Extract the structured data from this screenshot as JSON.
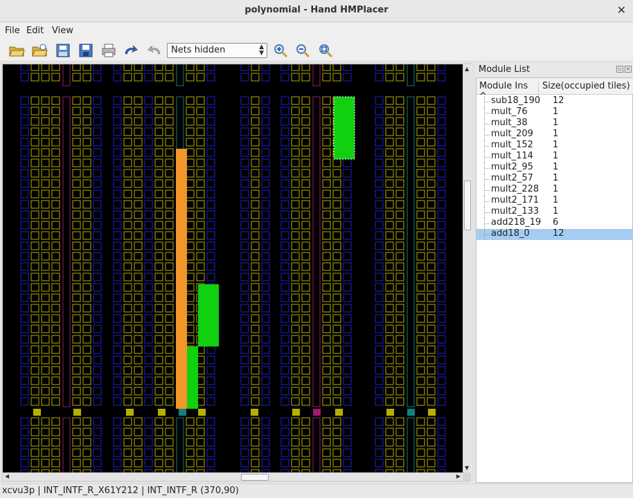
{
  "window": {
    "title": "polynomial - Hand HMPlacer",
    "close": "✕"
  },
  "menu": {
    "file": "File",
    "edit": "Edit",
    "view": "View"
  },
  "toolbar": {
    "nets_select": "Nets hidden",
    "icons": [
      "open-folder-icon",
      "open-recent-icon",
      "save-layout-icon",
      "save-icon",
      "print-icon",
      "redo-icon",
      "undo-icon",
      "zoom-in-icon",
      "zoom-out-icon",
      "zoom-fit-icon"
    ]
  },
  "module_list": {
    "title": "Module List",
    "col_instance": "Module Ins",
    "col_size": "Size(occupied tiles)",
    "items": [
      {
        "name": "sub18_190",
        "size": "12"
      },
      {
        "name": "mult_76",
        "size": "1"
      },
      {
        "name": "mult_38",
        "size": "1"
      },
      {
        "name": "mult_209",
        "size": "1"
      },
      {
        "name": "mult_152",
        "size": "1"
      },
      {
        "name": "mult_114",
        "size": "1"
      },
      {
        "name": "mult2_95",
        "size": "1"
      },
      {
        "name": "mult2_57",
        "size": "1"
      },
      {
        "name": "mult2_228",
        "size": "1"
      },
      {
        "name": "mult2_171",
        "size": "1"
      },
      {
        "name": "mult2_133",
        "size": "1"
      },
      {
        "name": "add218_19",
        "size": "6"
      },
      {
        "name": "add18_0",
        "size": "12"
      }
    ],
    "selected_index": 12
  },
  "colors": {
    "clb": "#b8b000",
    "interconnect": "#2020d0",
    "dsp": "#a01870",
    "bram": "#108080",
    "placed_orange": "#f0962a",
    "placed_green": "#10d010"
  },
  "status": "xcvu3p | INT_INTF_R_X61Y212 | INT_INTF_R (370,90)"
}
